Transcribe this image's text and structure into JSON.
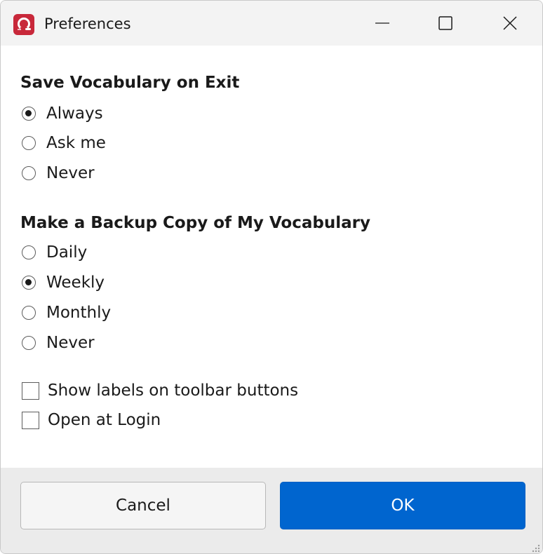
{
  "window": {
    "title": "Preferences"
  },
  "save_vocabulary": {
    "heading": "Save Vocabulary on Exit",
    "options": [
      {
        "label": "Always",
        "checked": true
      },
      {
        "label": "Ask me",
        "checked": false
      },
      {
        "label": "Never",
        "checked": false
      }
    ]
  },
  "backup": {
    "heading": "Make a Backup Copy of My Vocabulary",
    "options": [
      {
        "label": "Daily",
        "checked": false
      },
      {
        "label": "Weekly",
        "checked": true
      },
      {
        "label": "Monthly",
        "checked": false
      },
      {
        "label": "Never",
        "checked": false
      }
    ]
  },
  "checkboxes": [
    {
      "label": "Show labels on toolbar buttons",
      "checked": false
    },
    {
      "label": "Open at Login",
      "checked": false
    }
  ],
  "buttons": {
    "cancel_label": "Cancel",
    "ok_label": "OK"
  },
  "colors": {
    "accent": "#0065cf",
    "app_icon": "#c8283a",
    "titlebar_bg": "#f3f3f3",
    "footer_bg": "#ebebeb"
  },
  "icons": {
    "app": "app-logo-icon",
    "minimize": "minimize-icon",
    "maximize": "maximize-icon",
    "close": "close-icon"
  }
}
